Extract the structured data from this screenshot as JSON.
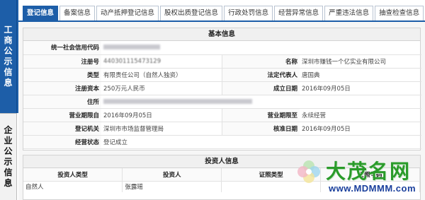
{
  "side": {
    "gov_chars": [
      "工",
      "商",
      "公",
      "示",
      "信",
      "息"
    ],
    "ent_chars": [
      "企",
      "业",
      "公",
      "示",
      "信",
      "息"
    ]
  },
  "tabs": [
    {
      "label": "登记信息",
      "active": true
    },
    {
      "label": "备案信息",
      "active": false
    },
    {
      "label": "动产抵押登记信息",
      "active": false
    },
    {
      "label": "股权出质登记信息",
      "active": false
    },
    {
      "label": "行政处罚信息",
      "active": false
    },
    {
      "label": "经营异常信息",
      "active": false
    },
    {
      "label": "严重违法信息",
      "active": false
    },
    {
      "label": "抽查检查信息",
      "active": false
    }
  ],
  "basic": {
    "title": "基本信息",
    "credit_code_label": "统一社会信用代码",
    "reg_no_label": "注册号",
    "reg_no_value": "440301115473129",
    "name_label": "名称",
    "name_value": "深圳市赚钱一个亿实业有限公司",
    "type_label": "类型",
    "type_value": "有限责任公司（自然人独资）",
    "legal_rep_label": "法定代表人",
    "legal_rep_value": "唐国典",
    "capital_label": "注册资本",
    "capital_value": "250万元人民币",
    "est_date_label": "成立日期",
    "est_date_value": "2016年09月05日",
    "address_label": "住所",
    "term_from_label": "营业期限自",
    "term_from_value": "2016年09月05日",
    "term_to_label": "营业期限至",
    "term_to_value": "永续经营",
    "authority_label": "登记机关",
    "authority_value": "深圳市市场监督管理局",
    "approval_label": "核准日期",
    "approval_value": "2016年09月05日",
    "status_label": "经营状态",
    "status_value": "登记成立"
  },
  "investor": {
    "title": "投资人信息",
    "headers": [
      "投资人类型",
      "投资人",
      "证照类型",
      "证照号码"
    ],
    "rows": [
      [
        "自然人",
        "张露瑶",
        "",
        ""
      ]
    ]
  },
  "watermark": {
    "title": "大茂名网",
    "url": "www.MDMMM.com"
  }
}
